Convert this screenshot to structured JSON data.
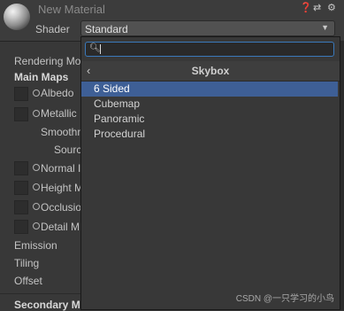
{
  "header": {
    "title": "New Material",
    "shader_label": "Shader",
    "shader_value": "Standard"
  },
  "inspector": {
    "rendering_mode": "Rendering Mo",
    "main_maps": "Main Maps",
    "albedo": "Albedo",
    "metallic": "Metallic",
    "smoothness": "Smoothn",
    "source": "Sourc",
    "normal_map": "Normal I",
    "height_map": "Height M",
    "occlusion": "Occlusio",
    "detail_mask": "Detail M",
    "emission": "Emission",
    "tiling": "Tiling",
    "offset": "Offset",
    "secondary_maps": "Secondary M"
  },
  "popup": {
    "search_placeholder": "",
    "header_title": "Skybox",
    "items": [
      "6 Sided",
      "Cubemap",
      "Panoramic",
      "Procedural"
    ],
    "selected_index": 0
  },
  "watermark": "CSDN @一只学习的小鸟",
  "colors": {
    "accent_blue": "#3e5f96",
    "search_focus": "#3a79bb",
    "background": "#383838"
  }
}
